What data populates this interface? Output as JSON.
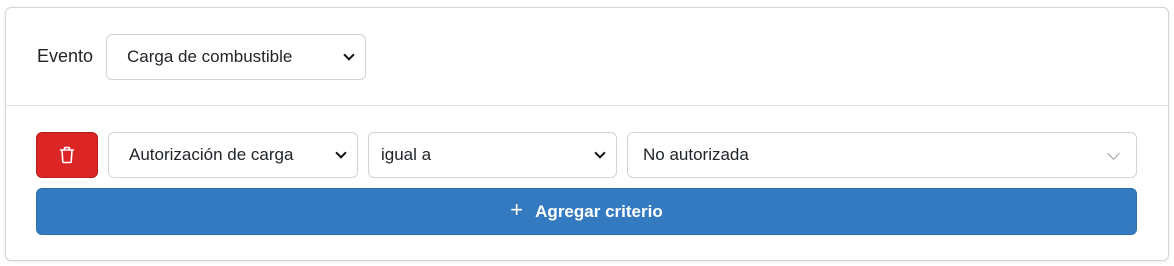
{
  "evento": {
    "label": "Evento",
    "selected": "Carga de combustible"
  },
  "criteria": [
    {
      "field": "Autorización de carga",
      "operator": "igual a",
      "value": "No autorizada"
    }
  ],
  "add_button": {
    "icon": "+",
    "label": "Agregar criterio"
  },
  "colors": {
    "delete": "#dc2626",
    "primary": "#337ac0"
  },
  "icons": {
    "delete": "trash-icon",
    "add": "plus-icon",
    "dropdown": "chevron-down-icon"
  }
}
